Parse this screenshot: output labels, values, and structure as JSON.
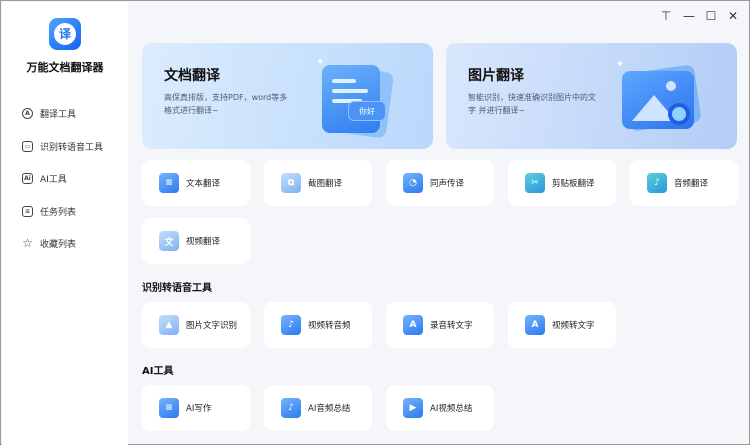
{
  "app": {
    "title": "万能文档翻译器",
    "logo_char": "译"
  },
  "window_controls": {
    "pin": "⊤",
    "minimize": "—",
    "maximize": "☐",
    "close": "✕"
  },
  "sidebar": {
    "items": [
      {
        "label": "翻译工具",
        "icon": "translate-icon"
      },
      {
        "label": "识别转语音工具",
        "icon": "scan-icon"
      },
      {
        "label": "AI工具",
        "icon": "ai-icon"
      },
      {
        "label": "任务列表",
        "icon": "task-list-icon"
      },
      {
        "label": "收藏列表",
        "icon": "star-icon"
      }
    ]
  },
  "hero": {
    "doc": {
      "title": "文档翻译",
      "desc": "高保真排版，支持PDF，word等多格式进行翻译~",
      "badge": "你好"
    },
    "image": {
      "title": "图片翻译",
      "desc": "智能识别，快速准确识别图片中的文字 并进行翻译~"
    }
  },
  "translate_tools": [
    {
      "label": "文本翻译",
      "glyph": "≡"
    },
    {
      "label": "截图翻译",
      "glyph": "⧉"
    },
    {
      "label": "同声传译",
      "glyph": "◔"
    },
    {
      "label": "剪贴板翻译",
      "glyph": "✂"
    },
    {
      "label": "音频翻译",
      "glyph": "♪"
    },
    {
      "label": "视频翻译",
      "glyph": "文"
    }
  ],
  "sections": {
    "speech": "识别转语音工具",
    "ai": "AI工具"
  },
  "speech_tools": [
    {
      "label": "图片文字识别",
      "glyph": "▲"
    },
    {
      "label": "视频转音频",
      "glyph": "♪"
    },
    {
      "label": "录音转文字",
      "glyph": "A"
    },
    {
      "label": "视频转文字",
      "glyph": "A"
    }
  ],
  "ai_tools": [
    {
      "label": "AI写作",
      "glyph": "≡"
    },
    {
      "label": "AI音频总结",
      "glyph": "♪"
    },
    {
      "label": "AI视频总结",
      "glyph": "▶"
    }
  ],
  "colors": {
    "accent": "#2c79ef",
    "background": "#f5f6f9"
  }
}
